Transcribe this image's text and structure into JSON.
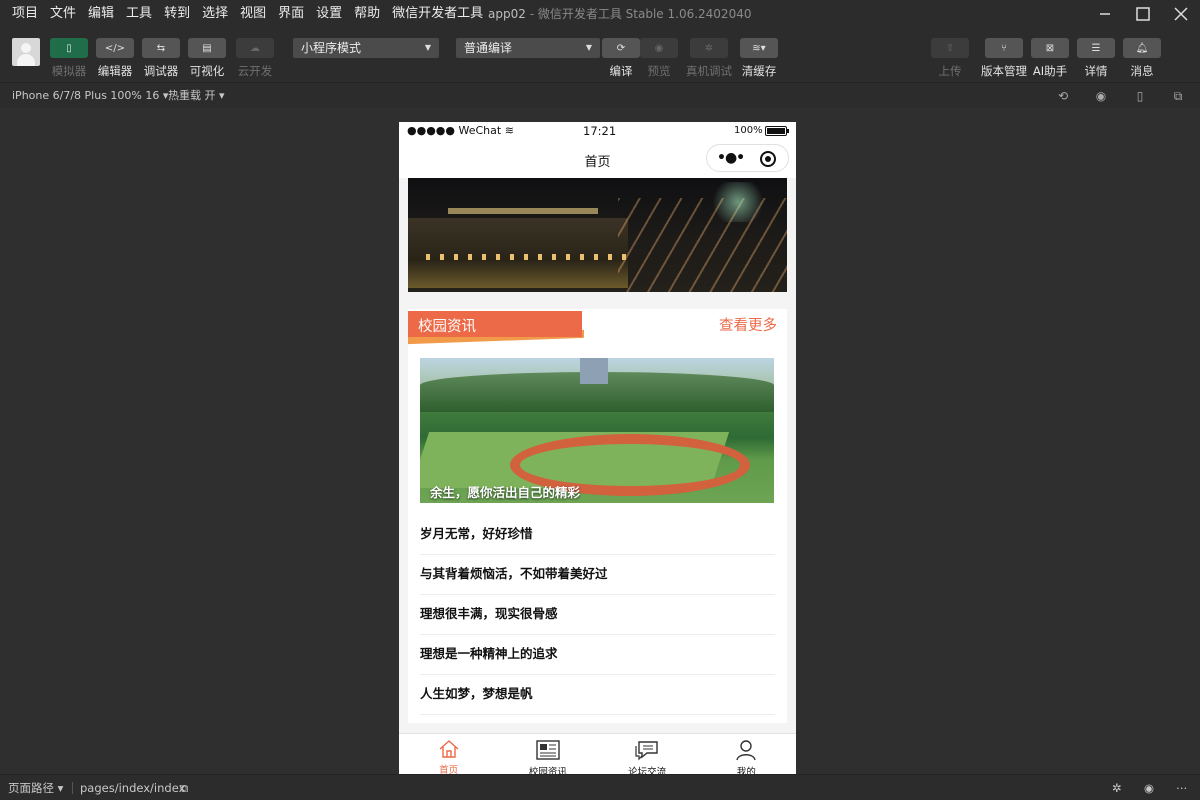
{
  "menu": [
    "项目",
    "文件",
    "编辑",
    "工具",
    "转到",
    "选择",
    "视图",
    "界面",
    "设置",
    "帮助",
    "微信开发者工具"
  ],
  "window": {
    "project": "app02",
    "separator": "-",
    "app_name": "微信开发者工具 Stable 1.06.2402040"
  },
  "toolbar": {
    "left_tools": [
      {
        "label": "模拟器",
        "icon": "phone-icon"
      },
      {
        "label": "编辑器",
        "icon": "code-icon"
      },
      {
        "label": "调试器",
        "icon": "debug-icon"
      },
      {
        "label": "可视化",
        "icon": "layout-icon"
      },
      {
        "label": "云开发",
        "icon": "cloud-icon"
      }
    ],
    "mode_select": "小程序模式",
    "compile_select": "普通编译",
    "compile_tools": [
      {
        "label": "编译",
        "icon": "refresh-icon"
      },
      {
        "label": "预览",
        "icon": "eye-icon"
      },
      {
        "label": "真机调试",
        "icon": "bug-icon"
      },
      {
        "label": "清缓存",
        "icon": "layers-icon"
      }
    ],
    "right_tools": [
      {
        "label": "上传",
        "icon": "upload-icon"
      },
      {
        "label": "版本管理",
        "icon": "branch-icon"
      },
      {
        "label": "AI助手",
        "icon": "ai-icon"
      },
      {
        "label": "详情",
        "icon": "menu-icon"
      },
      {
        "label": "消息",
        "icon": "bell-icon"
      }
    ]
  },
  "subbar": {
    "device": "iPhone 6/7/8 Plus 100% 16",
    "hot_reload": "热重载 开"
  },
  "phone": {
    "statusbar": {
      "carrier": "●●●●● WeChat",
      "time": "17:21",
      "battery": "100%"
    },
    "nav_title": "首页",
    "section_title": "校园资讯",
    "more_link": "查看更多",
    "feature_caption": "余生，愿你活出自己的精彩",
    "news": [
      "岁月无常，好好珍惜",
      "与其背着烦恼活，不如带着美好过",
      "理想很丰满，现实很骨感",
      "理想是一种精神上的追求",
      "人生如梦，梦想是帆"
    ],
    "tabs": [
      {
        "label": "首页",
        "icon": "home-icon"
      },
      {
        "label": "校园资讯",
        "icon": "newspaper-icon"
      },
      {
        "label": "论坛交流",
        "icon": "chat-icon"
      },
      {
        "label": "我的",
        "icon": "user-icon"
      }
    ]
  },
  "bottombar": {
    "path_label": "页面路径",
    "path": "pages/index/index"
  },
  "colors": {
    "accent": "#ec6a48",
    "ribbon_tail": "#f19a4a",
    "green_button": "#1f6e49"
  }
}
